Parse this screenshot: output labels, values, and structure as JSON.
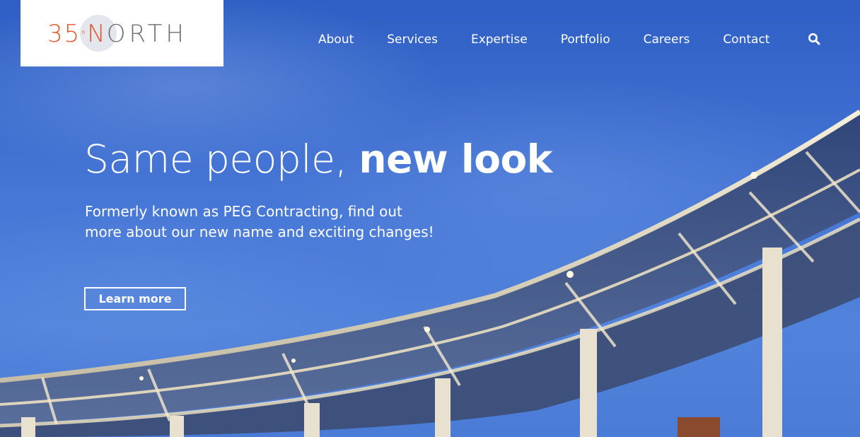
{
  "brand": {
    "logo_number": "35",
    "logo_degree": "°",
    "logo_first_letter": "N",
    "logo_rest": "ORTH",
    "primary_color": "#e2572b",
    "secondary_color": "#6c6f75"
  },
  "nav": {
    "items": [
      {
        "label": "About"
      },
      {
        "label": "Services"
      },
      {
        "label": "Expertise"
      },
      {
        "label": "Portfolio"
      },
      {
        "label": "Careers"
      },
      {
        "label": "Contact"
      }
    ],
    "search_icon": "search-icon"
  },
  "hero": {
    "headline_light": "Same people, ",
    "headline_bold": "new look",
    "subtext": "Formerly known as PEG Contracting, find out more about our new name and exciting changes!",
    "cta_label": "Learn more",
    "background_image": "solar-panel-canopy-against-blue-sky"
  }
}
